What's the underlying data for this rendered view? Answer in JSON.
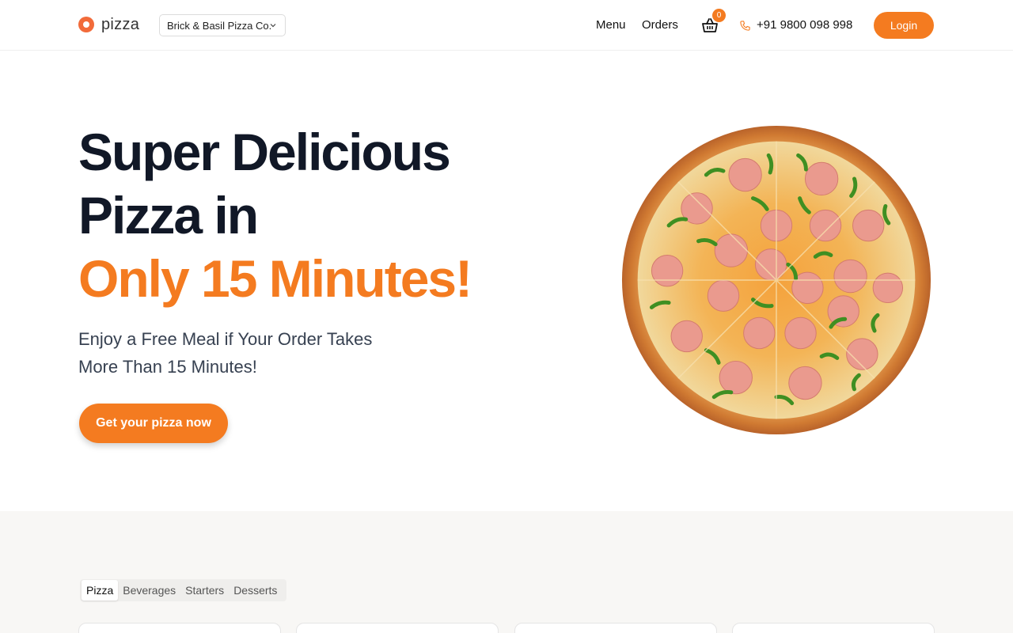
{
  "header": {
    "brand_name": "pizza",
    "store": "Brick & Basil Pizza Co.",
    "nav": {
      "menu": "Menu",
      "orders": "Orders"
    },
    "cart_count": "0",
    "phone": "+91 9800 098 998",
    "login": "Login"
  },
  "hero": {
    "title_line1": "Super Delicious",
    "title_line2": "Pizza in",
    "title_accent": "Only 15 Minutes!",
    "subtitle_line1": "Enjoy a Free Meal if Your Order Takes",
    "subtitle_line2": "More Than 15 Minutes!",
    "cta": "Get your pizza now"
  },
  "categories": {
    "tabs": [
      "Pizza",
      "Beverages",
      "Starters",
      "Desserts"
    ],
    "active": "Pizza"
  },
  "colors": {
    "accent": "#f47b20",
    "brand_dot": "#f26b3a",
    "heading": "#111827"
  },
  "icons": {
    "store_chevron": "chevron-down-icon",
    "cart": "basket-icon",
    "phone": "phone-icon"
  }
}
